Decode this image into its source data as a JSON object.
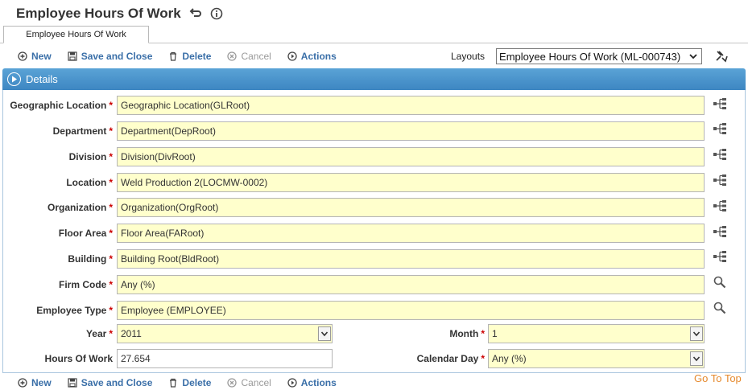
{
  "page": {
    "title": "Employee Hours Of Work",
    "tab_label": "Employee Hours Of Work"
  },
  "toolbar": {
    "new_label": "New",
    "save_close_label": "Save and Close",
    "delete_label": "Delete",
    "cancel_label": "Cancel",
    "actions_label": "Actions"
  },
  "layouts": {
    "label": "Layouts",
    "selected": "Employee Hours Of Work (ML-000743)"
  },
  "panel": {
    "header": "Details"
  },
  "fields": {
    "geographic_location": {
      "label": "Geographic Location",
      "value": "Geographic Location(GLRoot)"
    },
    "department": {
      "label": "Department",
      "value": "Department(DepRoot)"
    },
    "division": {
      "label": "Division",
      "value": "Division(DivRoot)"
    },
    "location": {
      "label": "Location",
      "value": "Weld Production 2(LOCMW-0002)"
    },
    "organization": {
      "label": "Organization",
      "value": "Organization(OrgRoot)"
    },
    "floor_area": {
      "label": "Floor Area",
      "value": "Floor Area(FARoot)"
    },
    "building": {
      "label": "Building",
      "value": "Building Root(BldRoot)"
    },
    "firm_code": {
      "label": "Firm Code",
      "value": "Any (%)"
    },
    "employee_type": {
      "label": "Employee Type",
      "value": "Employee (EMPLOYEE)"
    },
    "year": {
      "label": "Year",
      "value": "2011"
    },
    "month": {
      "label": "Month",
      "value": "1"
    },
    "hours_of_work": {
      "label": "Hours Of Work",
      "value": "27.654"
    },
    "calendar_day": {
      "label": "Calendar Day",
      "value": "Any (%)"
    }
  },
  "required_marker": "*",
  "footer": {
    "go_to_top": "Go To Top"
  },
  "colors": {
    "accent": "#3d86c2",
    "link": "#3a6fa8",
    "field_bg": "#ffffcc",
    "required": "#cc0000",
    "go_to_top": "#e68a2e"
  },
  "icons": {
    "undo": "undo-icon",
    "info": "info-icon",
    "tree": "hierarchy-tree-icon",
    "lookup": "magnifier-icon"
  }
}
